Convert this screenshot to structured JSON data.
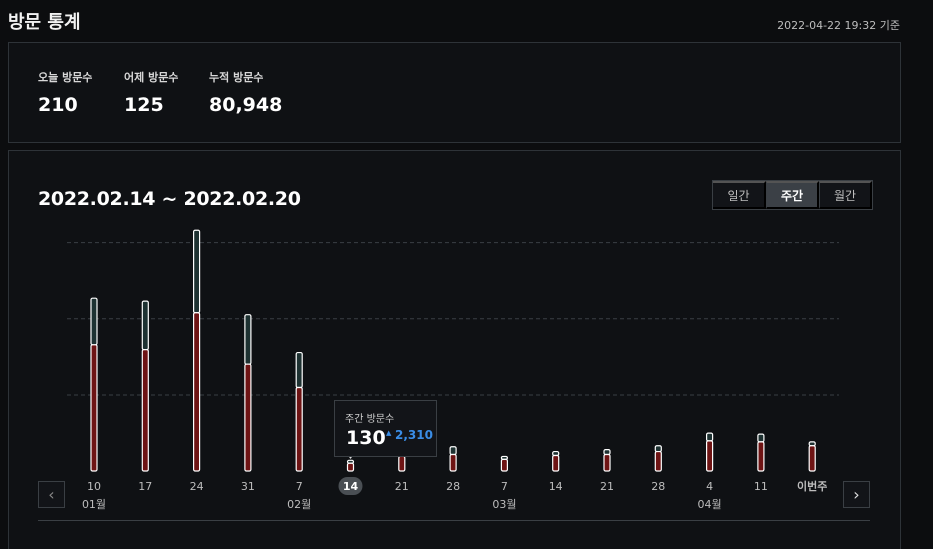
{
  "page": {
    "title": "방문 통계",
    "timestamp": "2022-04-22 19:32 기준"
  },
  "summary": [
    {
      "label": "오늘 방문수",
      "value": "210"
    },
    {
      "label": "어제 방문수",
      "value": "125"
    },
    {
      "label": "누적 방문수",
      "value": "80,948"
    }
  ],
  "range_title": "2022.02.14 ~ 2022.02.20",
  "period_tabs": [
    {
      "label": "일간",
      "active": false
    },
    {
      "label": "주간",
      "active": true
    },
    {
      "label": "월간",
      "active": false
    }
  ],
  "tooltip": {
    "label": "주간 방문수",
    "value": "130",
    "arrow": "▲",
    "total": "2,310"
  },
  "nav": {
    "prev": "‹",
    "next": "›"
  },
  "colors": {
    "bar_fill": "#6e1414",
    "bar_top": "#1e3232",
    "bar_stroke": "#ffffff",
    "grid": "#3a3f44",
    "accent_blue": "#3a8de6",
    "selected_badge": "#4a4f54"
  },
  "chart_data": {
    "type": "bar",
    "selected_index": 5,
    "categories": [
      "10",
      "17",
      "24",
      "31",
      "7",
      "14",
      "21",
      "28",
      "7",
      "14",
      "21",
      "28",
      "4",
      "11",
      "이번주"
    ],
    "month_labels": [
      {
        "index": 0,
        "label": "01월"
      },
      {
        "index": 4,
        "label": "02월"
      },
      {
        "index": 8,
        "label": "03월"
      },
      {
        "index": 12,
        "label": "04월"
      }
    ],
    "series": [
      {
        "values": [
          1300,
          1250,
          1630,
          1100,
          860,
          80,
          150,
          170,
          120,
          160,
          170,
          200,
          310,
          300,
          260
        ]
      },
      {
        "values": [
          480,
          500,
          850,
          510,
          360,
          30,
          40,
          80,
          30,
          40,
          50,
          60,
          80,
          80,
          40
        ]
      }
    ],
    "ylim": [
      0,
      2400
    ],
    "grid": true
  }
}
